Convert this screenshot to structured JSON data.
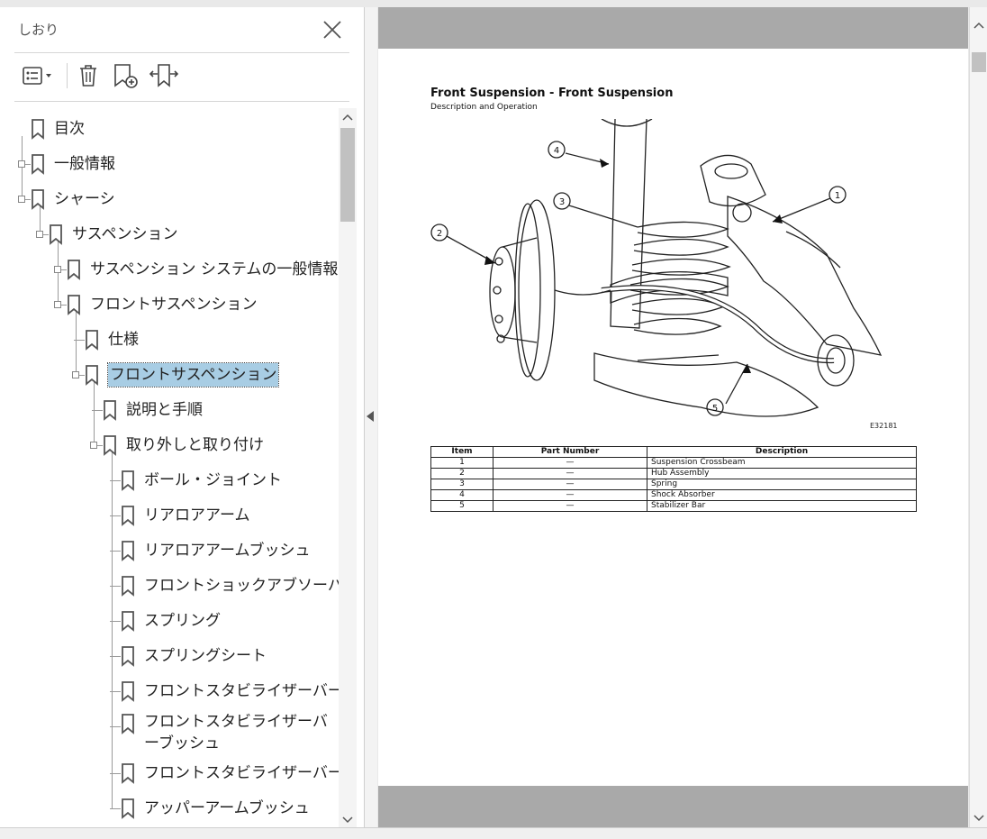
{
  "bookmarks_panel": {
    "title": "しおり",
    "tree": [
      {
        "label": "目次",
        "level": 0,
        "expander": false
      },
      {
        "label": "一般情報",
        "level": 0,
        "expander": true
      },
      {
        "label": "シャーシ",
        "level": 0,
        "expander": true
      },
      {
        "label": "サスペンション",
        "level": 1,
        "expander": true
      },
      {
        "label": "サスペンション システムの一般情報",
        "level": 2,
        "expander": true
      },
      {
        "label": "フロントサスペンション",
        "level": 2,
        "expander": true
      },
      {
        "label": "仕様",
        "level": 3,
        "expander": false
      },
      {
        "label": "フロントサスペンション",
        "level": 3,
        "expander": true,
        "selected": true
      },
      {
        "label": "説明と手順",
        "level": 4,
        "expander": false
      },
      {
        "label": "取り外しと取り付け",
        "level": 4,
        "expander": true
      },
      {
        "label": "ボール・ジョイント",
        "level": 5,
        "expander": false
      },
      {
        "label": "リアロアアーム",
        "level": 5,
        "expander": false
      },
      {
        "label": "リアロアアームブッシュ",
        "level": 5,
        "expander": false
      },
      {
        "label": "フロントショックアブソーバー",
        "level": 5,
        "expander": false
      },
      {
        "label": "スプリング",
        "level": 5,
        "expander": false
      },
      {
        "label": "スプリングシート",
        "level": 5,
        "expander": false
      },
      {
        "label": "フロントスタビライザーバー",
        "level": 5,
        "expander": false
      },
      {
        "label": "フロントスタビライザーバーブッシュ",
        "level": 5,
        "expander": false,
        "wrap": true
      },
      {
        "label": "フロントスタビライザーバーリンク",
        "level": 5,
        "expander": false
      },
      {
        "label": "アッパーアームブッシュ",
        "level": 5,
        "expander": false
      }
    ]
  },
  "toolbar": {
    "icons": [
      "options-menu-icon",
      "delete-icon",
      "new-bookmark-icon",
      "expand-bookmark-icon"
    ]
  },
  "document": {
    "title": "Front Suspension - Front Suspension",
    "subtitle": "Description and Operation",
    "figure_code": "E32181",
    "callouts": [
      "1",
      "2",
      "3",
      "4",
      "5"
    ],
    "table": {
      "headers": [
        "Item",
        "Part Number",
        "Description"
      ],
      "rows": [
        [
          "1",
          "—",
          "Suspension Crossbeam"
        ],
        [
          "2",
          "—",
          "Hub Assembly"
        ],
        [
          "3",
          "—",
          "Spring"
        ],
        [
          "4",
          "—",
          "Shock Absorber"
        ],
        [
          "5",
          "—",
          "Stabilizer Bar"
        ]
      ]
    }
  },
  "colors": {
    "selection": "#a8cde4",
    "page_background": "#a9a9a9"
  }
}
